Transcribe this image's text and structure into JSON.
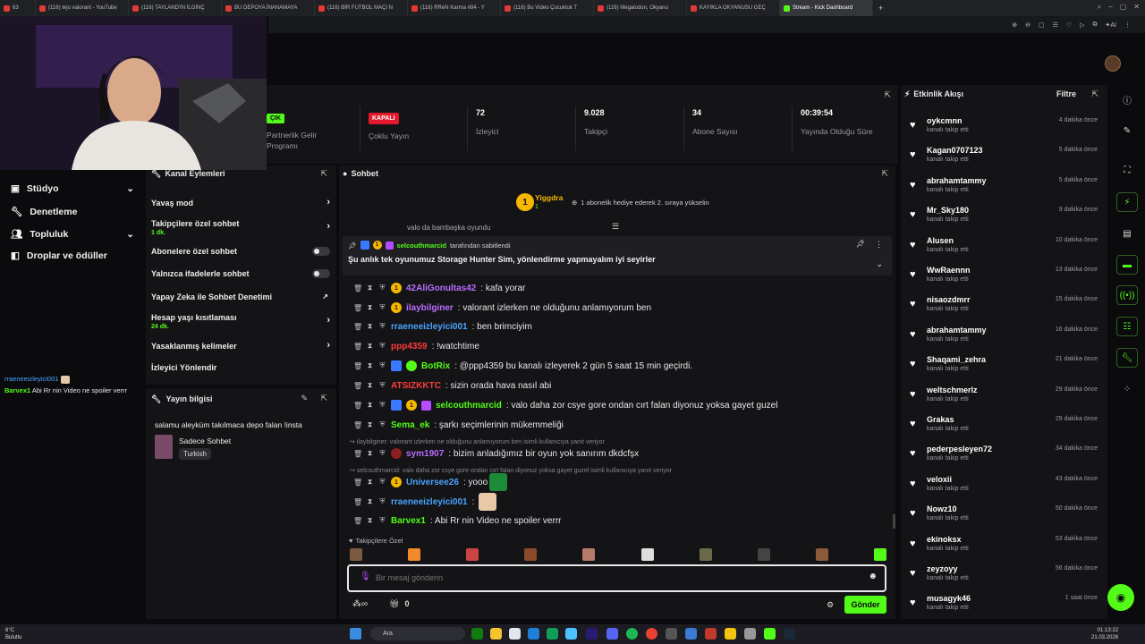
{
  "browser": {
    "tabs": [
      {
        "label": "63"
      },
      {
        "label": "(116) tejo valorant - YouTube"
      },
      {
        "label": "(116) TAYLAND'IN İLGİNÇ"
      },
      {
        "label": "BU DEPOYA İNANAMAYA"
      },
      {
        "label": "(116) BİR FUTBOL MAÇI N"
      },
      {
        "label": "(116) RReN Karma #84 - Y"
      },
      {
        "label": "(116) Bu Video Çocukluk T"
      },
      {
        "label": "(116) Megalodon, Okyanu"
      },
      {
        "label": "KAYIKLA OKYANUSU GEÇ"
      },
      {
        "label": "Stream - Kick Dashboard"
      }
    ],
    "new_tab": "+"
  },
  "stats": [
    {
      "value": "ÇIK",
      "label": "Partnerlik Gelir Programı"
    },
    {
      "value": "KAPALI",
      "label": "Çoklu Yayın"
    },
    {
      "value": "72",
      "label": "İzleyici"
    },
    {
      "value": "9.028",
      "label": "Takipçi"
    },
    {
      "value": "34",
      "label": "Abone Sayısı"
    },
    {
      "value": "00:39:54",
      "label": "Yayında Olduğu Süre"
    }
  ],
  "nav": [
    {
      "label": "Stüdyo"
    },
    {
      "label": "Denetleme"
    },
    {
      "label": "Topluluk"
    },
    {
      "label": "Droplar ve ödüller"
    }
  ],
  "mini_chat": [
    {
      "user": "rraeneeizleyici001",
      "text": ""
    },
    {
      "user": "Barvex1",
      "text": "Abi Rr nin Video ne spoiler verrr"
    }
  ],
  "kanal": {
    "title": "Kanal Eylemleri",
    "rows": [
      {
        "label": "Yavaş mod",
        "sub": ""
      },
      {
        "label": "Takipçilere özel sohbet",
        "sub": "1 dk."
      },
      {
        "label": "Abonelere özel sohbet",
        "sub": ""
      },
      {
        "label": "Yalnızca ifadelerle sohbet",
        "sub": ""
      },
      {
        "label": "Yapay Zeka ile Sohbet Denetimi",
        "sub": ""
      },
      {
        "label": "Hesap yaşı kısıtlaması",
        "sub": "24 dk."
      },
      {
        "label": "Yasaklanmış kelimeler",
        "sub": ""
      },
      {
        "label": "İzleyici Yönlendir",
        "sub": ""
      }
    ]
  },
  "yayin": {
    "title": "Yayın bilgisi",
    "stream_title": "salamu aleyküm takılmaca depo falan !insta",
    "category": "Sadece Sohbet",
    "language": "Turkish"
  },
  "chat": {
    "title": "Sohbet",
    "top_gifter": "Yiggdra",
    "top_gifter_count": "1",
    "gift_prompt": "1 abonelik hediye ederek 2. sıraya yükselin",
    "cut_msg": "valo da bambaşka oyundu",
    "pinned_by_user": "selcouthmarcid",
    "pinned_by_suffix": "tarafından sabitlendi",
    "pinned_text": "Şu anlık tek oyunumuz Storage Hunter Sim, yönlendirme yapmayalım iyi seyirler",
    "messages": [
      {
        "user": "42AliGonultas42",
        "color": "#b86cff",
        "text": ": kafa yorar"
      },
      {
        "user": "ilaybilginer",
        "color": "#b86cff",
        "text": ": valorant izlerken ne olduğunu anlamıyorum ben"
      },
      {
        "user": "rraeneeizleyici001",
        "color": "#4aa3ff",
        "text": ": ben brimciyim"
      },
      {
        "user": "ppp4359",
        "color": "#ff3b3b",
        "text": ": !watchtime"
      },
      {
        "user": "BotRix",
        "color": "#53fc18",
        "text": ": @ppp4359 bu kanalı izleyerek 2 gün 5 saat 15 min geçirdi."
      },
      {
        "user": "ATSIZKKTC",
        "color": "#ff3b3b",
        "text": ": sizin orada hava nasıl abi"
      },
      {
        "user": "selcouthmarcid",
        "color": "#53fc18",
        "text": ": valo daha zor csye gore ondan cırt falan diyonuz yoksa gayet guzel"
      },
      {
        "user": "Sema_ek",
        "color": "#53fc18",
        "text": ": şarkı seçimlerinin mükemmeliği"
      },
      {
        "user": "sym1907",
        "color": "#b86cff",
        "text": ": bizim anladığımız bir oyun yok sanırım dkdcfşx"
      },
      {
        "user": "Universee26",
        "color": "#4aa3ff",
        "text": ": yooo"
      },
      {
        "user": "rraeneeizleyici001",
        "color": "#4aa3ff",
        "text": ":"
      },
      {
        "user": "Barvex1",
        "color": "#53fc18",
        "text": ": Abi Rr nin Video ne spoiler verrr"
      }
    ],
    "replies": [
      "ilaybilginer: valorant izlerken ne olduğunu anlamıyorum ben isimli kullanıcıya yanıt veriyor",
      "selcouthmarcid: valo daha zor csye gore ondan cırt falan diyonuz yoksa gayet guzel isimli kullanıcıya yanıt veriyor"
    ],
    "followers_only": "Takipçilere Özel",
    "input_placeholder": "Bir mesaj gönderin",
    "gift_count": "0",
    "send": "Gönder"
  },
  "feed": {
    "title": "Etkinlik Akışı",
    "filter": "Filtre",
    "items": [
      {
        "name": "oykcmnn",
        "action": "kanalı takip etti",
        "time": "4 dakika önce"
      },
      {
        "name": "Kagan0707123",
        "action": "kanalı takip etti",
        "time": "5 dakika önce"
      },
      {
        "name": "abrahamtammy",
        "action": "kanalı takip etti",
        "time": "5 dakika önce"
      },
      {
        "name": "Mr_Sky180",
        "action": "kanalı takip etti",
        "time": "9 dakika önce"
      },
      {
        "name": "Alusen",
        "action": "kanalı takip etti",
        "time": "10 dakika önce"
      },
      {
        "name": "WwRaennn",
        "action": "kanalı takip etti",
        "time": "13 dakika önce"
      },
      {
        "name": "nisaozdmrr",
        "action": "kanalı takip etti",
        "time": "15 dakika önce"
      },
      {
        "name": "abrahamtammy",
        "action": "kanalı takip etti",
        "time": "16 dakika önce"
      },
      {
        "name": "Shaqami_zehra",
        "action": "kanalı takip etti",
        "time": "21 dakika önce"
      },
      {
        "name": "weltschmerlz",
        "action": "kanalı takip etti",
        "time": "29 dakika önce"
      },
      {
        "name": "Grakas",
        "action": "kanalı takip etti",
        "time": "29 dakika önce"
      },
      {
        "name": "pederpesleyen72",
        "action": "kanalı takip etti",
        "time": "34 dakika önce"
      },
      {
        "name": "veloxii",
        "action": "kanalı takip etti",
        "time": "43 dakika önce"
      },
      {
        "name": "Nowz10",
        "action": "kanalı takip etti",
        "time": "50 dakika önce"
      },
      {
        "name": "ekinoksx",
        "action": "kanalı takip etti",
        "time": "53 dakika önce"
      },
      {
        "name": "zeyzoyy",
        "action": "kanalı takip etti",
        "time": "56 dakika önce"
      },
      {
        "name": "musagyk46",
        "action": "kanalı takip etti",
        "time": "1 saat önce"
      }
    ]
  },
  "taskbar": {
    "weather_temp": "6°C",
    "weather_desc": "Bulutlu",
    "search": "Ara",
    "time": "01:13:22",
    "date": "21.03.2026"
  },
  "colors": {
    "brand": "#53fc18",
    "live_red": "#e3182d",
    "panel": "#141416",
    "bg": "#0b0b0d"
  }
}
